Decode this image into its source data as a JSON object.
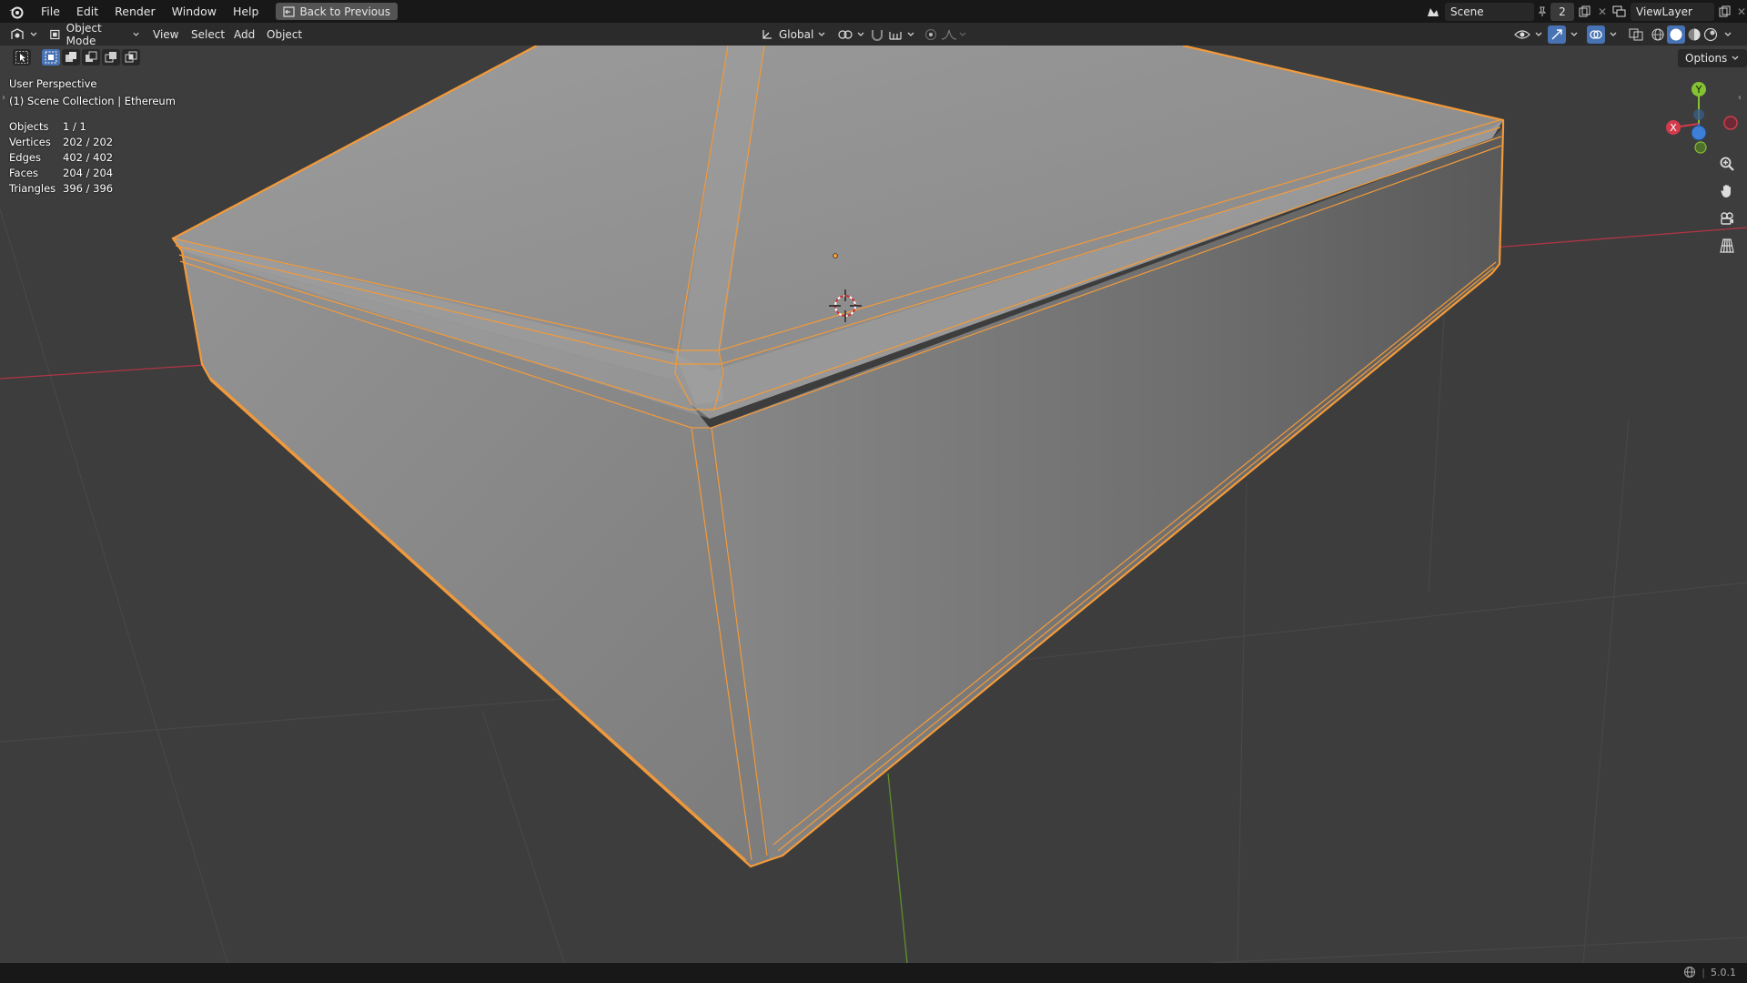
{
  "menu": {
    "file": "File",
    "edit": "Edit",
    "render": "Render",
    "window": "Window",
    "help": "Help",
    "back": "Back to Previous"
  },
  "scene": {
    "name": "Scene",
    "users": "2",
    "viewlayer": "ViewLayer"
  },
  "header": {
    "mode": "Object Mode",
    "view": "View",
    "select": "Select",
    "add": "Add",
    "object": "Object",
    "orientation": "Global"
  },
  "overlay": {
    "perspective": "User Perspective",
    "collection": "(1) Scene Collection | Ethereum",
    "options": "Options"
  },
  "stats": [
    {
      "label": "Objects",
      "value": "1 / 1"
    },
    {
      "label": "Vertices",
      "value": "202 / 202"
    },
    {
      "label": "Edges",
      "value": "402 / 402"
    },
    {
      "label": "Faces",
      "value": "204 / 204"
    },
    {
      "label": "Triangles",
      "value": "396 / 396"
    }
  ],
  "gizmo": {
    "x": "X",
    "y": "Y",
    "z": "Z"
  },
  "status": {
    "version": "5.0.1"
  },
  "colors": {
    "selection": "#f39a3a",
    "axis_x": "#d23b4b",
    "axis_y": "#85c233",
    "axis_z": "#3e7fd8"
  }
}
